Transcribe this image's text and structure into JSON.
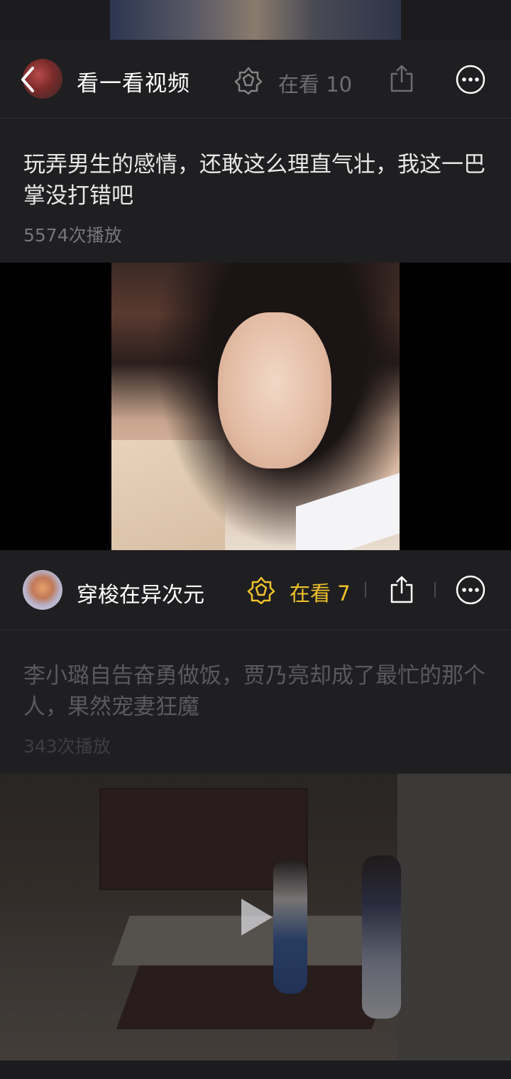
{
  "header": {
    "title": "看一看视频",
    "watching_label": "在看 10"
  },
  "video1": {
    "title": "玩弄男生的感情，还敢这么理直气壮，我这一巴掌没打错吧",
    "plays": "5574次播放"
  },
  "author": {
    "name": "穿梭在异次元",
    "watching_label": "在看 7"
  },
  "video2": {
    "title": "李小璐自告奋勇做饭，贾乃亮却成了最忙的那个人，果然宠妻狂魔",
    "plays": "343次播放"
  },
  "icons": {
    "back": "back-chevron-icon",
    "badge": "watching-badge-icon",
    "share": "share-icon",
    "more": "more-options-icon",
    "play": "play-icon"
  },
  "colors": {
    "background": "#1f1f21",
    "accent_yellow": "#f0c22b",
    "muted_text": "#77777b"
  }
}
